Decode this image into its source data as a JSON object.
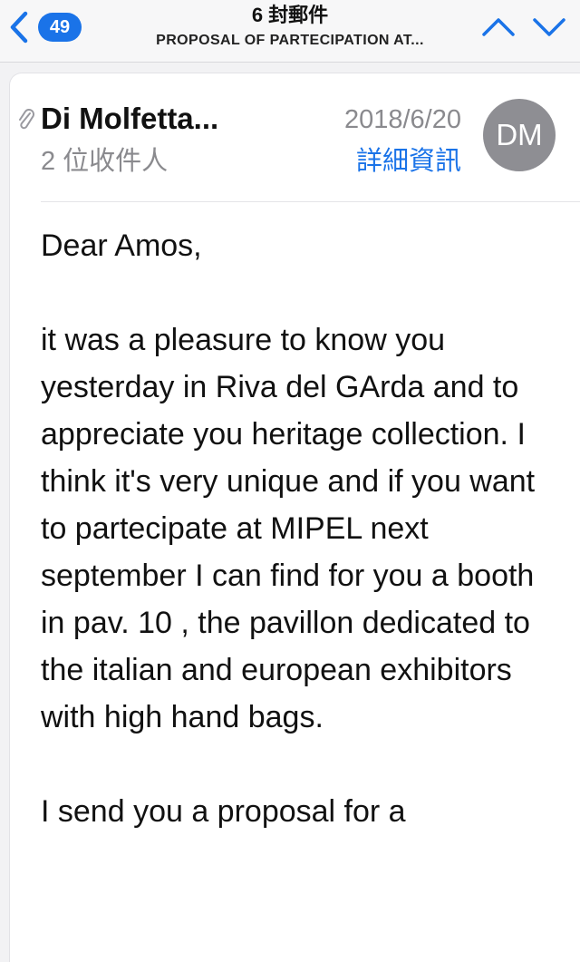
{
  "header": {
    "back_badge": "49",
    "title": "6 封郵件",
    "subtitle": "PROPOSAL OF PARTECIPATION AT..."
  },
  "icons": {
    "back": "chevron-left-icon",
    "prev": "chevron-up-icon",
    "next": "chevron-down-icon",
    "attachment": "paperclip-icon"
  },
  "colors": {
    "accent": "#1a73e8",
    "muted": "#8a8a8e",
    "avatar_bg": "#8e8e93"
  },
  "message": {
    "sender": "Di Molfetta...",
    "recipients": "2 位收件人",
    "date": "2018/6/20",
    "details_label": "詳細資訊",
    "avatar_initials": "DM",
    "greeting": "Dear Amos,",
    "paragraph1": "it was a pleasure to know you yesterday in Riva del GArda and to appreciate you heritage collection. I think it's very unique  and if you want  to partecipate at  MIPEL next september I can find for you  a booth in pav. 10 , the pavillon dedicated to the italian and european exhibitors with high hand bags.",
    "paragraph2": "I send you a proposal for a"
  }
}
